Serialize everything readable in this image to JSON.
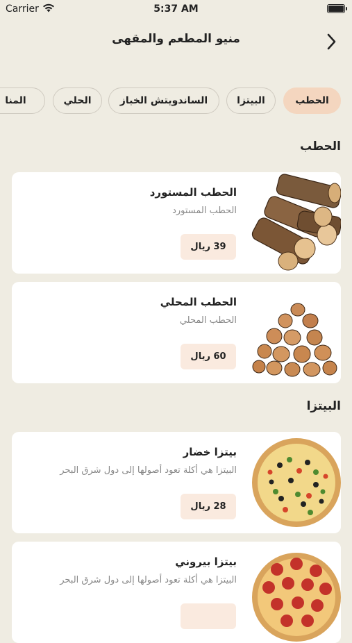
{
  "status": {
    "carrier": "Carrier",
    "time": "5:37 AM"
  },
  "header": {
    "title": "منيو المطعم والمقهى"
  },
  "tabs": [
    {
      "label": "الحطب",
      "active": true
    },
    {
      "label": "البيتزا",
      "active": false
    },
    {
      "label": "الساندويتش الخباز",
      "active": false
    },
    {
      "label": "الحلي",
      "active": false
    },
    {
      "label": "المنا",
      "active": false
    }
  ],
  "sections": [
    {
      "title": "الحطب",
      "items": [
        {
          "name": "الحطب المستورد",
          "desc": "الحطب المستورد",
          "price": "39 ريال",
          "icon": "firewood-logs-image"
        },
        {
          "name": "الحطب المحلي",
          "desc": "الحطب المحلي",
          "price": "60 ريال",
          "icon": "firewood-pile-image"
        }
      ]
    },
    {
      "title": "البيتزا",
      "items": [
        {
          "name": "بيتزا خضار",
          "desc": "البيتزا هي أكلة تعود أصولها إلى دول شرق البحر",
          "price": "28 ريال",
          "icon": "vegetable-pizza-image"
        },
        {
          "name": "بيتزا بيروني",
          "desc": "البيتزا هي أكلة تعود أصولها إلى دول شرق البحر",
          "price": "",
          "icon": "pepperoni-pizza-image"
        }
      ]
    }
  ],
  "colors": {
    "background": "#efece2",
    "tab_active": "#f4d6bf",
    "price_bg": "#faeadf",
    "card": "#ffffff"
  }
}
